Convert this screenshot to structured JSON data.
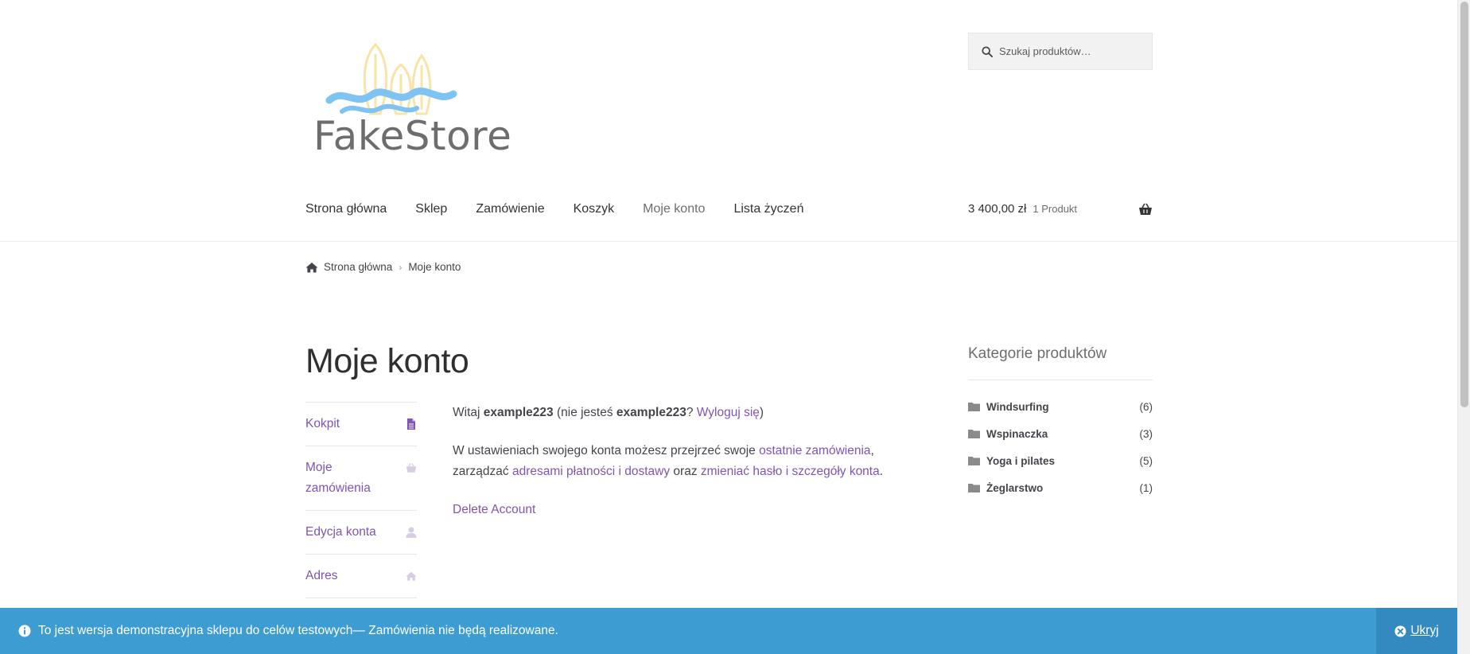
{
  "header": {
    "logo_text": "FakeStore",
    "search_placeholder": "Szukaj produktów…"
  },
  "nav": {
    "items": [
      {
        "label": "Strona główna"
      },
      {
        "label": "Sklep"
      },
      {
        "label": "Zamówienie"
      },
      {
        "label": "Koszyk"
      },
      {
        "label": "Moje konto"
      },
      {
        "label": "Lista życzeń"
      }
    ]
  },
  "cart": {
    "amount": "3 400,00 zł",
    "count": "1 Produkt"
  },
  "breadcrumb": {
    "home": "Strona główna",
    "separator": "›",
    "current": "Moje konto"
  },
  "page": {
    "title": "Moje konto"
  },
  "account_nav": {
    "items": [
      {
        "label": "Kokpit",
        "icon": "file-icon"
      },
      {
        "label": "Moje zamówienia",
        "icon": "basket-icon"
      },
      {
        "label": "Edycja konta",
        "icon": "user-icon"
      },
      {
        "label": "Adres",
        "icon": "home-icon"
      }
    ]
  },
  "content": {
    "greeting_prefix": "Witaj ",
    "username": "example223",
    "greeting_mid": " (nie jesteś ",
    "username_2": "example223",
    "greeting_q": "? ",
    "logout_link": "Wyloguj się",
    "greeting_end": ")",
    "desc_1": "W ustawieniach swojego konta możesz przejrzeć swoje ",
    "orders_link": "ostatnie zamówienia",
    "desc_2": ", zarządzać ",
    "addresses_link": "adresami płatności i dostawy",
    "desc_3": " oraz ",
    "password_link": "zmieniać hasło i szczegóły konta",
    "desc_4": ".",
    "delete_link": "Delete Account"
  },
  "sidebar": {
    "title": "Kategorie produktów",
    "categories": [
      {
        "name": "Windsurfing",
        "count": "(6)"
      },
      {
        "name": "Wspinaczka",
        "count": "(3)"
      },
      {
        "name": "Yoga i pilates",
        "count": "(5)"
      },
      {
        "name": "Żeglarstwo",
        "count": "(1)"
      }
    ]
  },
  "notice": {
    "text": "To jest wersja demonstracyjna sklepu do celów testowych— Zamówienia nie będą realizowane.",
    "dismiss": "Ukryj"
  },
  "colors": {
    "link": "#7f54b3",
    "notice_bg": "#3d9cd2",
    "notice_dismiss_bg": "#338ac0"
  }
}
